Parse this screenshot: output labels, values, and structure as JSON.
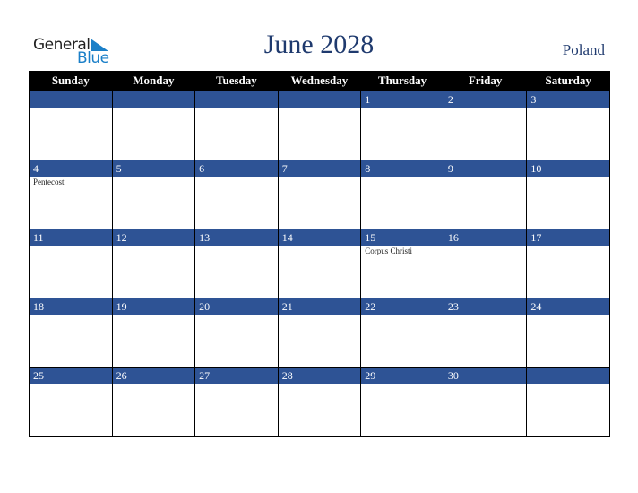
{
  "logo": {
    "general": "General",
    "blue": "Blue"
  },
  "title": "June 2028",
  "country": "Poland",
  "colors": {
    "band": "#2e5395",
    "header": "#000000",
    "title": "#1f3a6e",
    "logo_blue": "#1a7fc8"
  },
  "weekdays": [
    "Sunday",
    "Monday",
    "Tuesday",
    "Wednesday",
    "Thursday",
    "Friday",
    "Saturday"
  ],
  "weeks": [
    [
      {
        "day": "",
        "event": ""
      },
      {
        "day": "",
        "event": ""
      },
      {
        "day": "",
        "event": ""
      },
      {
        "day": "",
        "event": ""
      },
      {
        "day": "1",
        "event": ""
      },
      {
        "day": "2",
        "event": ""
      },
      {
        "day": "3",
        "event": ""
      }
    ],
    [
      {
        "day": "4",
        "event": "Pentecost"
      },
      {
        "day": "5",
        "event": ""
      },
      {
        "day": "6",
        "event": ""
      },
      {
        "day": "7",
        "event": ""
      },
      {
        "day": "8",
        "event": ""
      },
      {
        "day": "9",
        "event": ""
      },
      {
        "day": "10",
        "event": ""
      }
    ],
    [
      {
        "day": "11",
        "event": ""
      },
      {
        "day": "12",
        "event": ""
      },
      {
        "day": "13",
        "event": ""
      },
      {
        "day": "14",
        "event": ""
      },
      {
        "day": "15",
        "event": "Corpus Christi"
      },
      {
        "day": "16",
        "event": ""
      },
      {
        "day": "17",
        "event": ""
      }
    ],
    [
      {
        "day": "18",
        "event": ""
      },
      {
        "day": "19",
        "event": ""
      },
      {
        "day": "20",
        "event": ""
      },
      {
        "day": "21",
        "event": ""
      },
      {
        "day": "22",
        "event": ""
      },
      {
        "day": "23",
        "event": ""
      },
      {
        "day": "24",
        "event": ""
      }
    ],
    [
      {
        "day": "25",
        "event": ""
      },
      {
        "day": "26",
        "event": ""
      },
      {
        "day": "27",
        "event": ""
      },
      {
        "day": "28",
        "event": ""
      },
      {
        "day": "29",
        "event": ""
      },
      {
        "day": "30",
        "event": ""
      },
      {
        "day": "",
        "event": ""
      }
    ]
  ]
}
